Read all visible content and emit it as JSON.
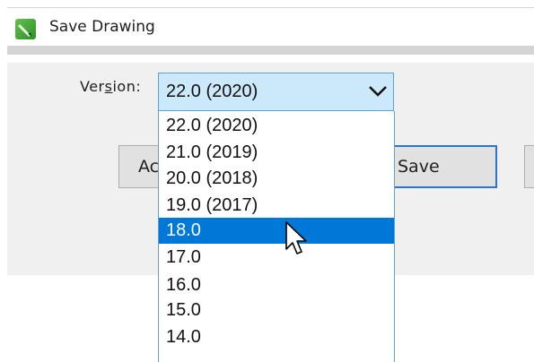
{
  "window": {
    "title": "Save Drawing",
    "icon": "coreldraw-app-icon"
  },
  "form": {
    "version_label": "Version:",
    "version_label_mnemonic": "s",
    "selected_value": "22.0 (2020)"
  },
  "dropdown": {
    "options": [
      "22.0 (2020)",
      "21.0 (2019)",
      "20.0 (2018)",
      "19.0 (2017)",
      "18.0",
      "17.0",
      "16.0",
      "15.0",
      "14.0"
    ],
    "highlighted_option": "18.0"
  },
  "buttons": {
    "left_partial_label": "Ac",
    "save_label": "Save"
  },
  "colors": {
    "selection": "#0078d7",
    "select_focus_bg": "#cce8fb",
    "select_border": "#5aa3d8",
    "save_border": "#2b75c4"
  }
}
